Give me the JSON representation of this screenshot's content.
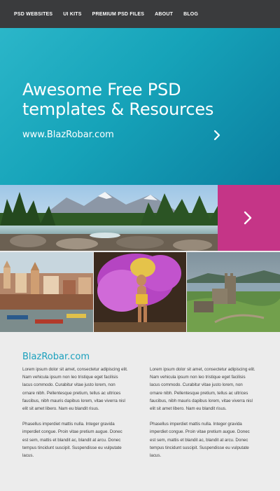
{
  "nav": {
    "items": [
      {
        "label": "PSD WEBSITES"
      },
      {
        "label": "UI KITS"
      },
      {
        "label": "PREMIUM PSD FILES"
      },
      {
        "label": "ABOUT"
      },
      {
        "label": "BLOG"
      }
    ]
  },
  "hero": {
    "title_line1": "Awesome Free PSD",
    "title_line2": "templates & Resources",
    "url": "www.BlazRobar.com",
    "arrow_icon": "chevron-right-icon"
  },
  "gallery": {
    "accent_color": "#c53587",
    "next_icon": "chevron-right-icon"
  },
  "content": {
    "heading": "BlazRobar.com",
    "col1": {
      "p1": "Lorem ipsum dolor sit amet, consectetur adipiscing elit. Nam vehicula ipsum non leo tristique eget facilisis lacus commodo. Curabitur vitae justo lorem, non ornare nibh. Pellentesque pretium, tellus ac ultrices faucibus, nibh mauris dapibus lorem, vitae viverra nisl elit sit amet libero. Nam eu blandit risus.",
      "p2": "Phasellus imperdiet mattis nulla. Integer gravida imperdiet congue. Proin vitae pretium augue. Donec est sem, mattis et blandit ac, blandit at arcu. Donec tempus tincidunt suscipit. Suspendisse eu vulputate lacus."
    },
    "col2": {
      "p1": "Lorem ipsum dolor sit amet, consectetur adipiscing elit. Nam vehicula ipsum non leo tristique eget facilisis lacus commodo. Curabitur vitae justo lorem, non ornare nibh. Pellentesque pretium, tellus ac ultrices faucibus, nibh mauris dapibus lorem, vitae viverra nisl elit sit amet libero. Nam eu blandit risus.",
      "p2": "Phasellus imperdiet mattis nulla. Integer gravida imperdiet congue. Proin vitae pretium augue. Donec est sem, mattis et blandit ac, blandit at arcu. Donec tempus tincidunt suscipit. Suspendisse eu vulputate lacus."
    }
  }
}
